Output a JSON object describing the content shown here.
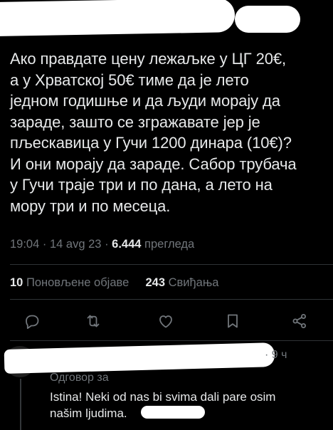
{
  "tweet": {
    "text": "Ако правдате цену лежаљке у ЦГ 20€,\nа у Хрватској 50€ тиме да је лето\nједном годишње и да људи морају да\nзараде, зашто се згражавате јер је\nпљескавица у Гучи 1200 динара (10€)?\nИ они морају да зараде. Сабор трубача\nу Гучи траје три и по дана, а лето на\nмору три и по месеца.",
    "time": "19:04",
    "sep": "·",
    "date": "14 avg 23",
    "views_count": "6.444",
    "views_label": "прегледа"
  },
  "stats": {
    "reposts_count": "10",
    "reposts_label": "Поновљене објаве",
    "likes_count": "243",
    "likes_label": "Свиђања"
  },
  "actions": {
    "reply_icon": "reply-icon",
    "repost_icon": "repost-icon",
    "like_icon": "heart-icon",
    "bookmark_icon": "bookmark-icon",
    "share_icon": "share-icon"
  },
  "reply": {
    "time": "· 9 ч",
    "replying_to": "Одговор за",
    "text": "Istina! Neki od nas bi svima dali pare osim\nnašim ljudima."
  },
  "colors": {
    "background": "#000000",
    "text_primary": "#e7e9ea",
    "text_secondary": "#71767b",
    "divider": "#2f3336",
    "redaction": "#ffffff"
  }
}
